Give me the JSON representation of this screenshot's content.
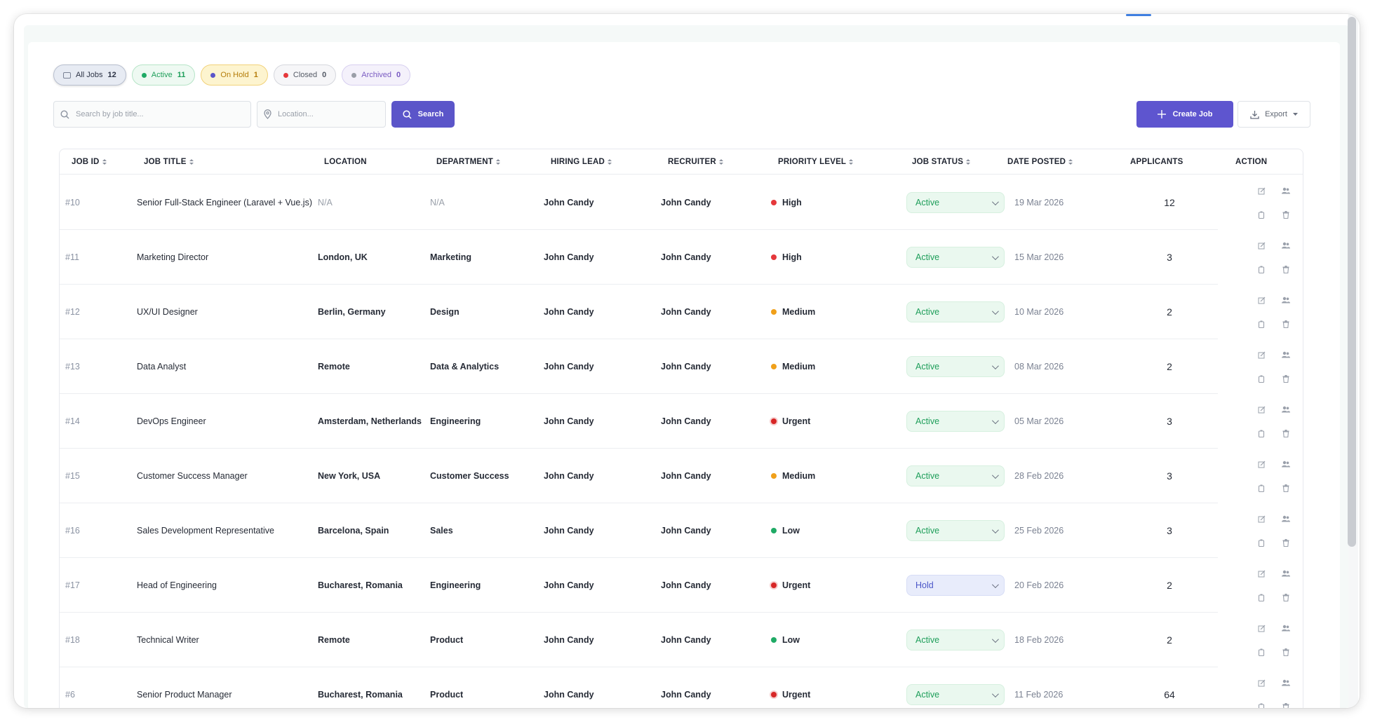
{
  "filters": [
    {
      "label": "All Jobs",
      "count": "12"
    },
    {
      "label": "Active",
      "count": "11"
    },
    {
      "label": "On Hold",
      "count": "1"
    },
    {
      "label": "Closed",
      "count": "0"
    },
    {
      "label": "Archived",
      "count": "0"
    }
  ],
  "search": {
    "title_placeholder": "Search by job title...",
    "location_placeholder": "Location...",
    "button_label": "Search"
  },
  "toolbar": {
    "create_label": "Create Job",
    "export_label": "Export"
  },
  "table": {
    "headers": {
      "job_id": "JOB ID",
      "job_title": "JOB TITLE",
      "location": "LOCATION",
      "department": "DEPARTMENT",
      "hiring_lead": "HIRING LEAD",
      "recruiter": "RECRUITER",
      "priority": "PRIORITY LEVEL",
      "status": "JOB STATUS",
      "date": "DATE POSTED",
      "applicants": "APPLICANTS",
      "action": "ACTION"
    },
    "rows": [
      {
        "id": "#10",
        "title": "Senior Full-Stack Engineer (Laravel + Vue.js)",
        "location": "N/A",
        "department": "N/A",
        "hiring_lead": "John Candy",
        "recruiter": "John Candy",
        "priority": "High",
        "status": "Active",
        "date": "19 Mar 2026",
        "applicants": "12"
      },
      {
        "id": "#11",
        "title": "Marketing Director",
        "location": "London, UK",
        "department": "Marketing",
        "hiring_lead": "John Candy",
        "recruiter": "John Candy",
        "priority": "High",
        "status": "Active",
        "date": "15 Mar 2026",
        "applicants": "3"
      },
      {
        "id": "#12",
        "title": "UX/UI Designer",
        "location": "Berlin, Germany",
        "department": "Design",
        "hiring_lead": "John Candy",
        "recruiter": "John Candy",
        "priority": "Medium",
        "status": "Active",
        "date": "10 Mar 2026",
        "applicants": "2"
      },
      {
        "id": "#13",
        "title": "Data Analyst",
        "location": "Remote",
        "department": "Data & Analytics",
        "hiring_lead": "John Candy",
        "recruiter": "John Candy",
        "priority": "Medium",
        "status": "Active",
        "date": "08 Mar 2026",
        "applicants": "2"
      },
      {
        "id": "#14",
        "title": "DevOps Engineer",
        "location": "Amsterdam, Netherlands",
        "department": "Engineering",
        "hiring_lead": "John Candy",
        "recruiter": "John Candy",
        "priority": "Urgent",
        "status": "Active",
        "date": "05 Mar 2026",
        "applicants": "3"
      },
      {
        "id": "#15",
        "title": "Customer Success Manager",
        "location": "New York, USA",
        "department": "Customer Success",
        "hiring_lead": "John Candy",
        "recruiter": "John Candy",
        "priority": "Medium",
        "status": "Active",
        "date": "28 Feb 2026",
        "applicants": "3"
      },
      {
        "id": "#16",
        "title": "Sales Development Representative",
        "location": "Barcelona, Spain",
        "department": "Sales",
        "hiring_lead": "John Candy",
        "recruiter": "John Candy",
        "priority": "Low",
        "status": "Active",
        "date": "25 Feb 2026",
        "applicants": "3"
      },
      {
        "id": "#17",
        "title": "Head of Engineering",
        "location": "Bucharest, Romania",
        "department": "Engineering",
        "hiring_lead": "John Candy",
        "recruiter": "John Candy",
        "priority": "Urgent",
        "status": "Hold",
        "date": "20 Feb 2026",
        "applicants": "2"
      },
      {
        "id": "#18",
        "title": "Technical Writer",
        "location": "Remote",
        "department": "Product",
        "hiring_lead": "John Candy",
        "recruiter": "John Candy",
        "priority": "Low",
        "status": "Active",
        "date": "18 Feb 2026",
        "applicants": "2"
      },
      {
        "id": "#6",
        "title": "Senior Product Manager",
        "location": "Bucharest, Romania",
        "department": "Product",
        "hiring_lead": "John Candy",
        "recruiter": "John Candy",
        "priority": "Urgent",
        "status": "Active",
        "date": "11 Feb 2026",
        "applicants": "64"
      }
    ]
  },
  "colors": {
    "priority": {
      "High": "#e5383b",
      "Urgent": "#d72626",
      "Medium": "#f0a01a",
      "Low": "#1faa65"
    },
    "primary": "#5e55cf"
  },
  "icons": {
    "row_actions": [
      "edit-icon",
      "applicants-icon",
      "copy-icon",
      "delete-icon"
    ]
  }
}
